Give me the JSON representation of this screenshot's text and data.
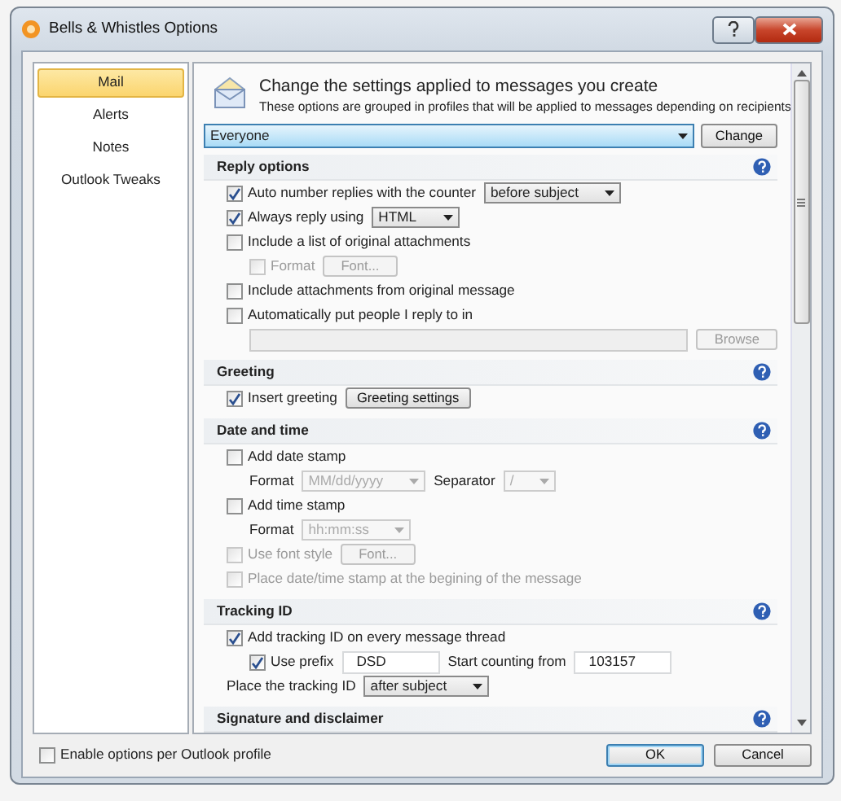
{
  "window": {
    "title": "Bells & Whistles Options"
  },
  "sidebar": {
    "items": [
      {
        "label": "Mail",
        "selected": true
      },
      {
        "label": "Alerts",
        "selected": false
      },
      {
        "label": "Notes",
        "selected": false
      },
      {
        "label": "Outlook Tweaks",
        "selected": false
      }
    ]
  },
  "header": {
    "title": "Change the settings applied to messages you create",
    "subtitle": "These options are grouped in profiles that will be applied to messages depending on recipients"
  },
  "profile": {
    "value": "Everyone",
    "button": "Change"
  },
  "sections": [
    {
      "title": "Reply options",
      "rows": [
        {
          "controls": [
            {
              "kind": "checkbox",
              "label": "Auto number replies with the counter",
              "checked": true,
              "disabled": false
            },
            {
              "kind": "select",
              "value": "before subject",
              "disabled": false
            }
          ]
        },
        {
          "controls": [
            {
              "kind": "checkbox",
              "label": "Always reply using",
              "checked": true,
              "disabled": false
            },
            {
              "kind": "select",
              "value": "HTML",
              "disabled": false
            }
          ]
        },
        {
          "controls": [
            {
              "kind": "checkbox",
              "label": "Include a list of original attachments",
              "checked": false,
              "disabled": false
            }
          ],
          "children": [
            {
              "controls": [
                {
                  "kind": "checkbox",
                  "label": "Format",
                  "checked": false,
                  "disabled": true
                },
                {
                  "kind": "button",
                  "label": "Font...",
                  "disabled": true
                }
              ]
            }
          ]
        },
        {
          "controls": [
            {
              "kind": "checkbox",
              "label": "Include attachments from original message",
              "checked": false,
              "disabled": false
            }
          ]
        },
        {
          "controls": [
            {
              "kind": "checkbox",
              "label": "Automatically put people I reply to in",
              "checked": false,
              "disabled": false
            }
          ],
          "children": [
            {
              "controls": [
                {
                  "kind": "input",
                  "disabled": true
                },
                {
                  "kind": "button",
                  "label": "Browse",
                  "disabled": true
                }
              ]
            }
          ]
        }
      ]
    },
    {
      "title": "Greeting",
      "rows": [
        {
          "controls": [
            {
              "kind": "checkbox",
              "label": "Insert greeting",
              "checked": true,
              "disabled": false
            },
            {
              "kind": "button",
              "label": "Greeting settings",
              "disabled": false
            }
          ]
        }
      ]
    },
    {
      "title": "Date and time",
      "rows": [
        {
          "controls": [
            {
              "kind": "checkbox",
              "label": "Add date stamp",
              "checked": false,
              "disabled": false
            }
          ],
          "children": [
            {
              "controls": [
                {
                  "kind": "label",
                  "text": "Format",
                  "disabled": false
                },
                {
                  "kind": "select",
                  "value": "MM/dd/yyyy",
                  "disabled": true
                },
                {
                  "kind": "label",
                  "text": "Separator",
                  "disabled": false
                },
                {
                  "kind": "select",
                  "value": "/",
                  "disabled": true
                }
              ]
            }
          ]
        },
        {
          "controls": [
            {
              "kind": "checkbox",
              "label": "Add time stamp",
              "checked": false,
              "disabled": false
            }
          ],
          "children": [
            {
              "controls": [
                {
                  "kind": "label",
                  "text": "Format",
                  "disabled": false
                },
                {
                  "kind": "select",
                  "value": "hh:mm:ss",
                  "disabled": true
                }
              ]
            }
          ]
        },
        {
          "controls": [
            {
              "kind": "checkbox",
              "label": "Use font style",
              "checked": false,
              "disabled": true
            },
            {
              "kind": "button",
              "label": "Font...",
              "disabled": true
            }
          ]
        },
        {
          "controls": [
            {
              "kind": "checkbox",
              "label": "Place date/time stamp at the begining of the message",
              "checked": false,
              "disabled": true
            }
          ]
        }
      ]
    },
    {
      "title": "Tracking ID",
      "rows": [
        {
          "controls": [
            {
              "kind": "checkbox",
              "label": "Add tracking ID on every message thread",
              "checked": true,
              "disabled": false
            }
          ],
          "children": [
            {
              "controls": [
                {
                  "kind": "checkbox",
                  "label": "Use prefix",
                  "checked": true,
                  "disabled": false
                },
                {
                  "kind": "input",
                  "value": "DSD",
                  "disabled": false
                },
                {
                  "kind": "label",
                  "text": "Start counting from",
                  "disabled": false
                },
                {
                  "kind": "input",
                  "value": "103157",
                  "disabled": false
                }
              ]
            }
          ]
        },
        {
          "controls": [
            {
              "kind": "label",
              "text": "Place the tracking ID",
              "disabled": false
            },
            {
              "kind": "select",
              "value": "after subject",
              "disabled": false
            }
          ]
        }
      ]
    },
    {
      "title": "Signature and disclaimer"
    }
  ],
  "footer": {
    "profile_option": {
      "label": "Enable options per Outlook profile",
      "checked": false
    },
    "buttons": [
      {
        "label": "OK",
        "default": true
      },
      {
        "label": "Cancel",
        "default": false
      }
    ]
  }
}
